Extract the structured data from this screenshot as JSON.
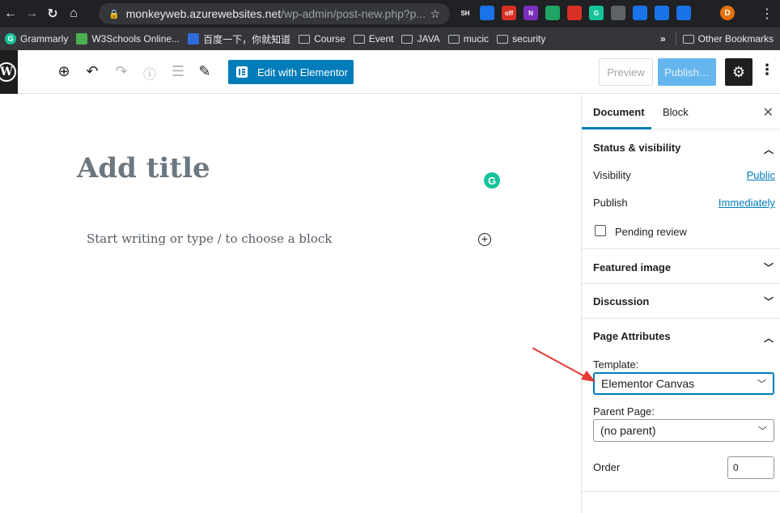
{
  "browser": {
    "url_host": "monkeyweb.azurewebsites.net",
    "url_path": "/wp-admin/post-new.php?p...",
    "extensions": [
      {
        "label": "SH",
        "color": "#202124"
      },
      {
        "label": "",
        "color": "#1a73e8"
      },
      {
        "label": "off",
        "color": "#d93025"
      },
      {
        "label": "N",
        "color": "#7b2fbe"
      },
      {
        "label": "",
        "color": "#1fa463"
      },
      {
        "label": "",
        "color": "#d93025"
      },
      {
        "label": "G",
        "color": "#15c39a"
      },
      {
        "label": "",
        "color": "#5f6368"
      },
      {
        "label": "",
        "color": "#1a73e8"
      },
      {
        "label": "",
        "color": "#1a73e8"
      },
      {
        "label": "",
        "color": "#1a73e8"
      },
      {
        "label": "",
        "color": "#202124"
      }
    ],
    "profile_initial": "D"
  },
  "bookmarks": {
    "items": [
      "Grammarly",
      "W3Schools Online...",
      "百度一下，你就知道",
      "Course",
      "Event",
      "JAVA",
      "mucic",
      "security"
    ],
    "overflow": "»",
    "other": "Other Bookmarks"
  },
  "toolbar": {
    "elementor_label": "Edit with Elementor",
    "preview_label": "Preview",
    "publish_label": "Publish…"
  },
  "editor": {
    "title_placeholder": "Add title",
    "body_placeholder": "Start writing or type / to choose a block"
  },
  "sidebar": {
    "tab_document": "Document",
    "tab_block": "Block",
    "status": {
      "title": "Status & visibility",
      "visibility_label": "Visibility",
      "visibility_value": "Public",
      "publish_label": "Publish",
      "publish_value": "Immediately",
      "pending_label": "Pending review"
    },
    "featured_image": "Featured image",
    "discussion": "Discussion",
    "page_attributes": {
      "title": "Page Attributes",
      "template_label": "Template:",
      "template_value": "Elementor Canvas",
      "parent_label": "Parent Page:",
      "parent_value": "(no parent)",
      "order_label": "Order",
      "order_value": "0"
    }
  },
  "colors": {
    "accent": "#007cba",
    "annotation": "#e53935"
  }
}
